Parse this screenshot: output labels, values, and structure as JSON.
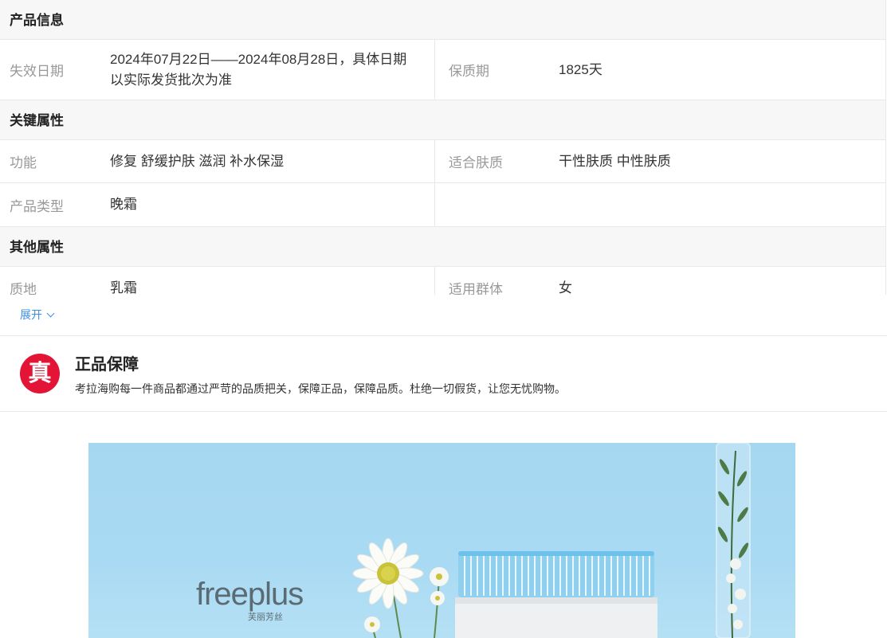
{
  "product_info": {
    "heading": "产品信息",
    "rows": [
      {
        "l1": "失效日期",
        "v1": "2024年07月22日——2024年08月28日，具体日期以实际发货批次为准",
        "l2": "保质期",
        "v2": "1825天"
      }
    ]
  },
  "key_attrs": {
    "heading": "关键属性",
    "rows": [
      {
        "l1": "功能",
        "v1": "修复 舒缓护肤 滋润 补水保湿",
        "l2": "适合肤质",
        "v2": "干性肤质 中性肤质"
      },
      {
        "l1": "产品类型",
        "v1": "晚霜",
        "l2": "",
        "v2": ""
      }
    ]
  },
  "other_attrs": {
    "heading": "其他属性",
    "rows": [
      {
        "l1": "质地",
        "v1": "乳霜",
        "l2": "适用群体",
        "v2": "女"
      }
    ]
  },
  "expand_label": "展开",
  "guarantee": {
    "badge": "真",
    "title": "正品保障",
    "desc": "考拉海购每一件商品都通过严苛的品质把关，保障正品，保障品质。杜绝一切假货，让您无忧购物。"
  },
  "banner": {
    "brand": "freeplus",
    "brand_cn": "芙丽芳丝"
  }
}
